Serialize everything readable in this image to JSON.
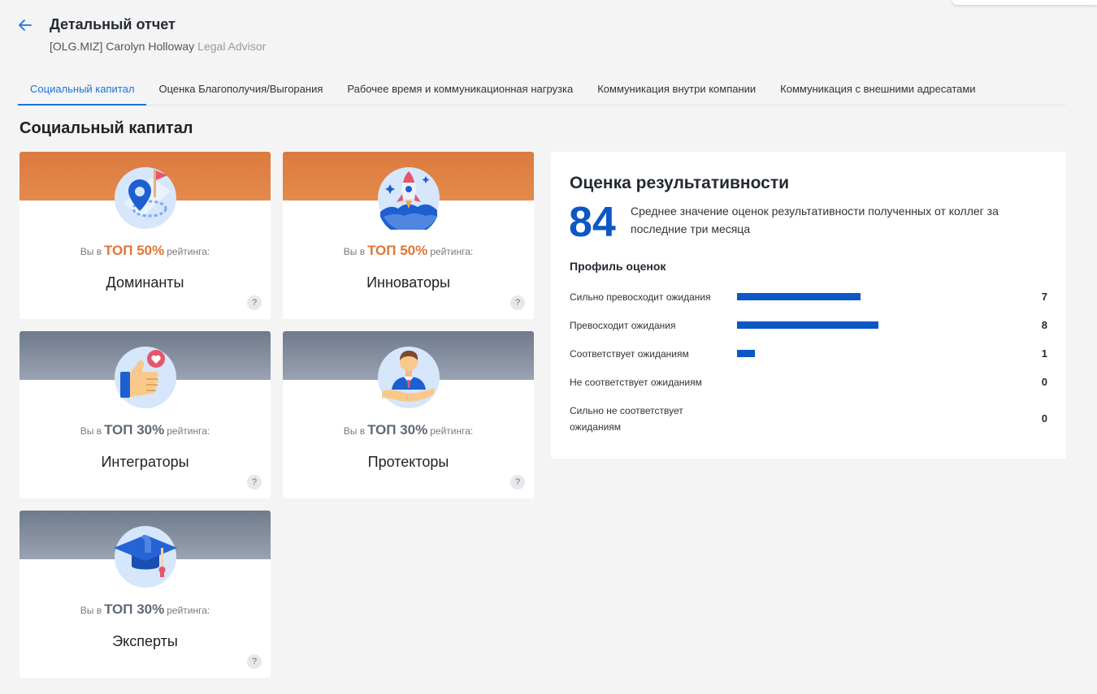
{
  "header": {
    "title": "Детальный отчет",
    "user": "[OLG.MIZ] Carolyn Holloway",
    "role": "Legal Advisor"
  },
  "tabs": [
    {
      "label": "Социальный капитал",
      "active": true
    },
    {
      "label": "Оценка Благополучия/Выгорания",
      "active": false
    },
    {
      "label": "Рабочее время и коммуникационная нагрузка",
      "active": false
    },
    {
      "label": "Коммуникация внутри компании",
      "active": false
    },
    {
      "label": "Коммуникация с внешними адресатами",
      "active": false
    }
  ],
  "section_title": "Социальный капитал",
  "rank_prefix": "Вы в",
  "rank_suffix": "рейтинга:",
  "help_label": "?",
  "cards": [
    {
      "top": "ТОП 50%",
      "name": "Доминанты",
      "icon": "map-pin-flag-icon",
      "color": "#e07536"
    },
    {
      "top": "ТОП 50%",
      "name": "Инноваторы",
      "icon": "rocket-icon",
      "color": "#e07536"
    },
    {
      "top": "ТОП 30%",
      "name": "Интеграторы",
      "icon": "thumbs-up-heart-icon",
      "color": "#5f6878"
    },
    {
      "top": "ТОП 30%",
      "name": "Протекторы",
      "icon": "person-hand-icon",
      "color": "#5f6878"
    },
    {
      "top": "ТОП 30%",
      "name": "Эксперты",
      "icon": "graduation-cap-icon",
      "color": "#5f6878"
    }
  ],
  "performance": {
    "title": "Оценка результативности",
    "score": "84",
    "description": "Среднее значение оценок результативности полученных от коллег за последние три месяца",
    "profile_title": "Профиль оценок",
    "rows": [
      {
        "label": "Сильно превосходит ожидания",
        "count": 7
      },
      {
        "label": "Превосходит ожидания",
        "count": 8
      },
      {
        "label": "Соответствует ожиданиям",
        "count": 1
      },
      {
        "label": "Не соответствует ожиданиям",
        "count": 0
      },
      {
        "label": "Сильно не соответствует ожиданиям",
        "count": 0
      }
    ],
    "bar_color": "#0b57c5"
  }
}
